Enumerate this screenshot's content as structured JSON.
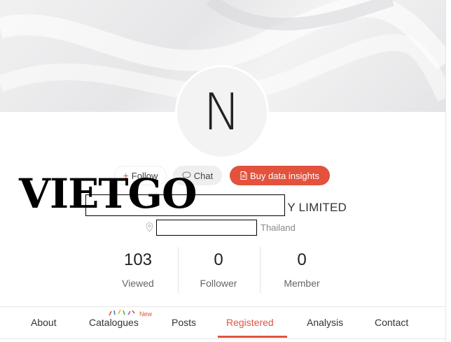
{
  "profile": {
    "avatar_letter": "N",
    "company_name": "Y LIMITED",
    "location_country": "Thailand"
  },
  "actions": {
    "follow_plus": "+",
    "follow_label": "Follow",
    "chat_label": "Chat",
    "buy_label": "Buy data insights"
  },
  "watermark": {
    "text": "VIETGO"
  },
  "stats": [
    {
      "value": "103",
      "label": "Viewed"
    },
    {
      "value": "0",
      "label": "Follower"
    },
    {
      "value": "0",
      "label": "Member"
    }
  ],
  "tabs": [
    {
      "label": "About"
    },
    {
      "label": "Catalogues",
      "badge": "New"
    },
    {
      "label": "Posts"
    },
    {
      "label": "Registered",
      "active": true
    },
    {
      "label": "Analysis"
    },
    {
      "label": "Contact"
    }
  ],
  "colors": {
    "accent": "#e2523d",
    "chat_bg": "#efefef",
    "cover_bg": "#e9e9eb"
  },
  "icons": {
    "chat": "chat-bubble-icon",
    "buy": "document-icon",
    "location": "location-pin-icon"
  }
}
